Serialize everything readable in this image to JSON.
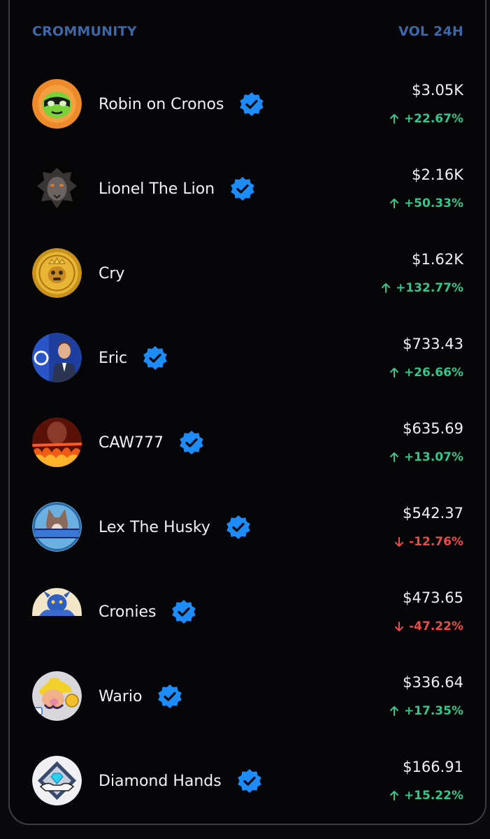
{
  "header": {
    "left_label": "CROMMUNITY",
    "right_label": "VOL 24H"
  },
  "colors": {
    "header": "#3f66a6",
    "up": "#35c68c",
    "down": "#ec4b4b",
    "verified": "#1d8cf8",
    "background": "#060609"
  },
  "rows": [
    {
      "name": "Robin on Cronos",
      "verified": true,
      "volume": "$3.05K",
      "change": "+22.67%",
      "direction": "up",
      "icon": "green-masked-face-avatar"
    },
    {
      "name": "Lionel The Lion",
      "verified": true,
      "volume": "$2.16K",
      "change": "+50.33%",
      "direction": "up",
      "icon": "lion-avatar"
    },
    {
      "name": "Cry",
      "verified": false,
      "volume": "$1.62K",
      "change": "+132.77%",
      "direction": "up",
      "icon": "gold-coin-avatar"
    },
    {
      "name": "Eric",
      "verified": true,
      "volume": "$733.43",
      "change": "+26.66%",
      "direction": "up",
      "icon": "man-in-suit-avatar"
    },
    {
      "name": "CAW777",
      "verified": true,
      "volume": "$635.69",
      "change": "+13.07%",
      "direction": "up",
      "icon": "fire-avatar"
    },
    {
      "name": "Lex The Husky",
      "verified": true,
      "volume": "$542.37",
      "change": "-12.76%",
      "direction": "down",
      "icon": "husky-avatar"
    },
    {
      "name": "Cronies",
      "verified": true,
      "volume": "$473.65",
      "change": "-47.22%",
      "direction": "down",
      "icon": "blue-monster-avatar"
    },
    {
      "name": "Wario",
      "verified": true,
      "volume": "$336.64",
      "change": "+17.35%",
      "direction": "up",
      "icon": "wario-avatar"
    },
    {
      "name": "Diamond Hands",
      "verified": true,
      "volume": "$166.91",
      "change": "+15.22%",
      "direction": "up",
      "icon": "diamond-hands-avatar"
    }
  ]
}
